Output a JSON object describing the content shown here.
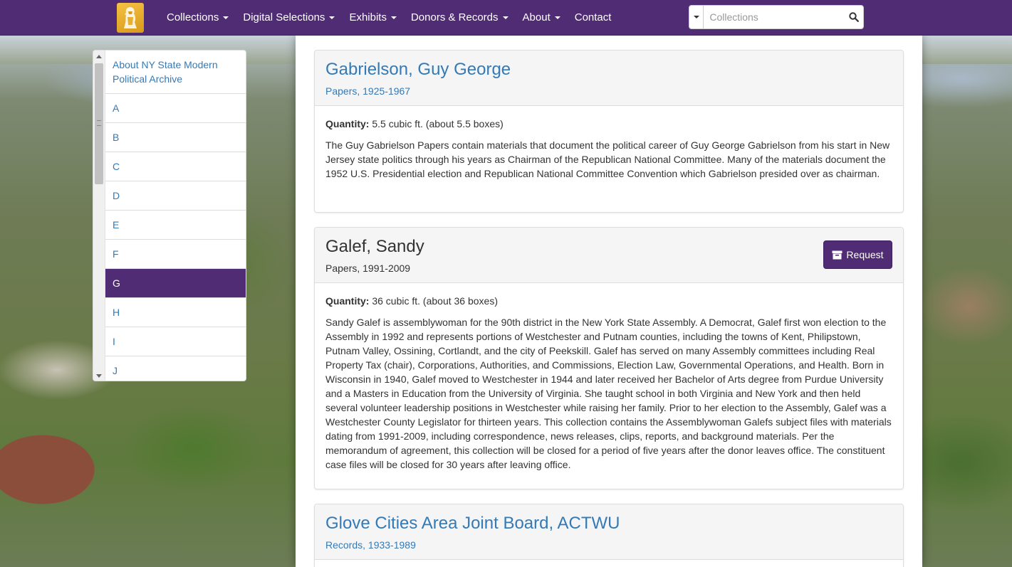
{
  "navbar": {
    "logo_icon": "archive-logo-icon",
    "items": [
      {
        "label": "Collections",
        "dropdown": true
      },
      {
        "label": "Digital Selections",
        "dropdown": true
      },
      {
        "label": "Exhibits",
        "dropdown": true
      },
      {
        "label": "Donors & Records",
        "dropdown": true
      },
      {
        "label": "About",
        "dropdown": true
      },
      {
        "label": "Contact",
        "dropdown": false
      }
    ],
    "search": {
      "placeholder": "Collections",
      "value": "",
      "icon": "search-icon"
    },
    "brand_color": "#4f2c73"
  },
  "sidebar": {
    "items": [
      {
        "label": "About NY State Modern Political Archive",
        "active": false
      },
      {
        "label": "A",
        "active": false
      },
      {
        "label": "B",
        "active": false
      },
      {
        "label": "C",
        "active": false
      },
      {
        "label": "D",
        "active": false
      },
      {
        "label": "E",
        "active": false
      },
      {
        "label": "F",
        "active": false
      },
      {
        "label": "G",
        "active": true
      },
      {
        "label": "H",
        "active": false
      },
      {
        "label": "I",
        "active": false
      },
      {
        "label": "J",
        "active": false
      }
    ]
  },
  "collections": [
    {
      "title": "Gabrielson, Guy George",
      "subtitle": "Papers, 1925-1967",
      "linked": true,
      "quantity_label": "Quantity:",
      "quantity": "5.5 cubic ft. (about 5.5 boxes)",
      "description": "The Guy Gabrielson Papers contain materials that document the political career of Guy George Gabrielson from his start in New Jersey state politics through his years as Chairman of the Republican National Committee. Many of the materials document the 1952 U.S. Presidential election and Republican National Committee Convention which Gabrielson presided over as chairman."
    },
    {
      "title": "Galef, Sandy",
      "subtitle": "Papers, 1991-2009",
      "linked": false,
      "request_label": "Request",
      "quantity_label": "Quantity:",
      "quantity": "36 cubic ft. (about 36 boxes)",
      "description": "Sandy Galef is assemblywoman for the 90th district in the New York State Assembly. A Democrat, Galef first won election to the Assembly in 1992 and represents portions of Westchester and Putnam counties, including the towns of Kent, Philipstown, Putnam Valley, Ossining, Cortlandt, and the city of Peekskill. Galef has served on many Assembly committees including Real Property Tax (chair), Corporations, Authorities, and Commissions, Election Law, Governmental Operations, and Health. Born in Wisconsin in 1940, Galef moved to Westchester in 1944 and later received her Bachelor of Arts degree from Purdue University and a Masters in Education from the University of Virginia. She taught school in both Virginia and New York and then held several volunteer leadership positions in Westchester while raising her family. Prior to her election to the Assembly, Galef was a Westchester County Legislator for thirteen years. This collection contains the Assemblywoman Galefs subject files with materials dating from 1991-2009, including correspondence, news releases, clips, reports, and background materials. Per the memorandum of agreement, this collection will be closed for a period of five years after the donor leaves office. The constituent case files will be closed for 30 years after leaving office."
    },
    {
      "title": "Glove Cities Area Joint Board, ACTWU",
      "subtitle": "Records, 1933-1989",
      "linked": true
    }
  ]
}
